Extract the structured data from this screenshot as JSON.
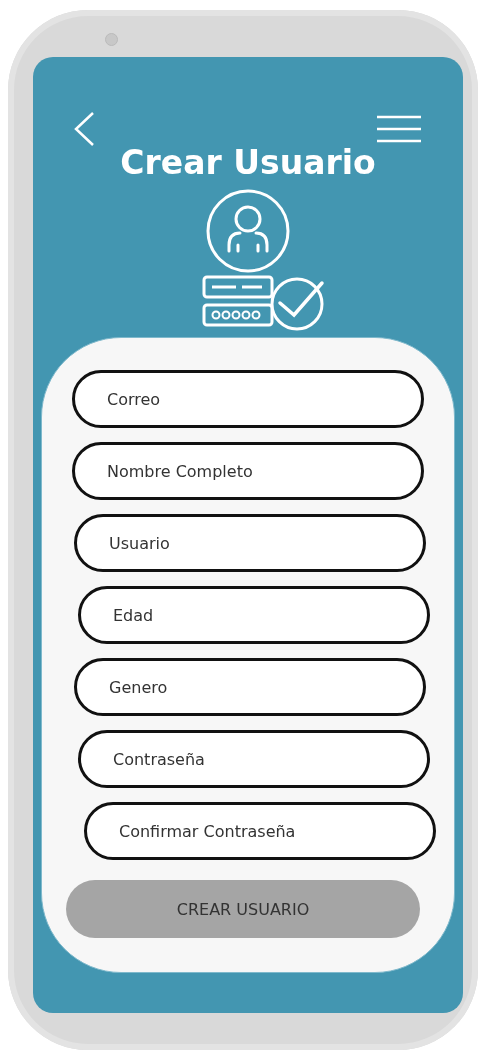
{
  "header": {
    "title": "Crear Usuario"
  },
  "form": {
    "fields": [
      {
        "placeholder": "Correo"
      },
      {
        "placeholder": "Nombre Completo"
      },
      {
        "placeholder": "Usuario"
      },
      {
        "placeholder": "Edad"
      },
      {
        "placeholder": "Genero"
      },
      {
        "placeholder": "Contraseña"
      },
      {
        "placeholder": "Confirmar Contraseña"
      }
    ],
    "submit": "CREAR USUARIO"
  }
}
